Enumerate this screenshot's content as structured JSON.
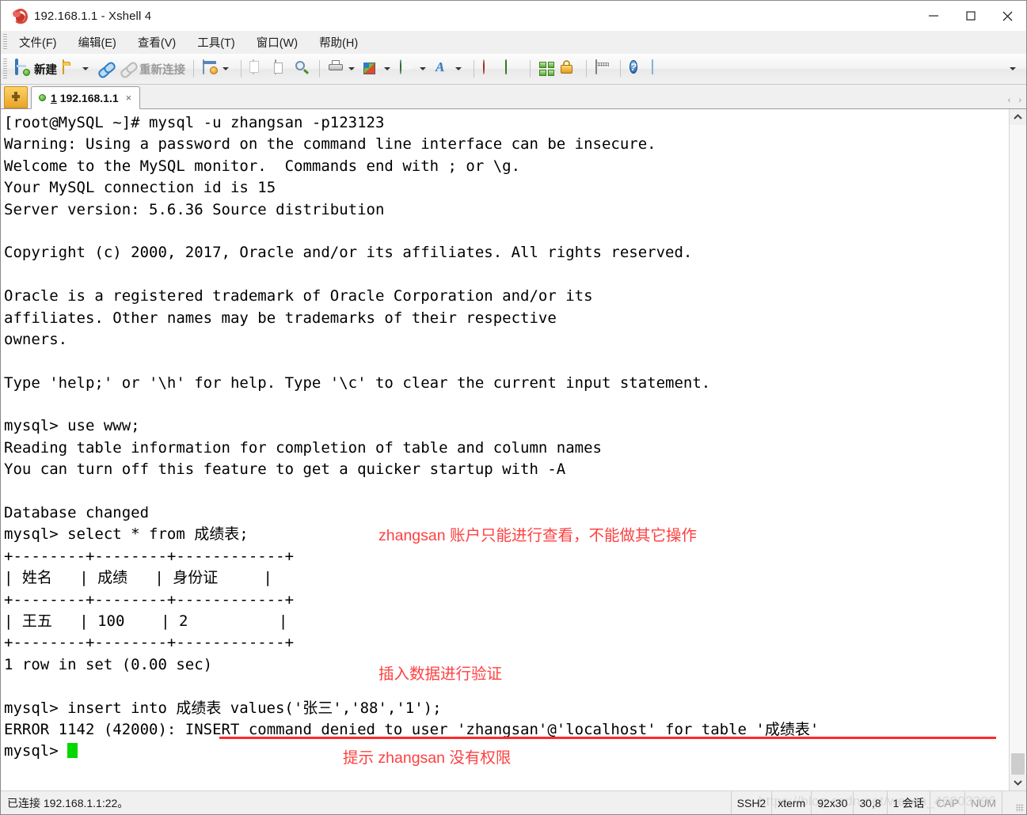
{
  "window": {
    "title": "192.168.1.1 - Xshell 4",
    "app_icon": "snail-icon",
    "minimize": "minimize-icon",
    "maximize": "maximize-icon",
    "close": "close-icon"
  },
  "menubar": {
    "items": [
      {
        "label": "文件(F)"
      },
      {
        "label": "编辑(E)"
      },
      {
        "label": "查看(V)"
      },
      {
        "label": "工具(T)"
      },
      {
        "label": "窗口(W)"
      },
      {
        "label": "帮助(H)"
      }
    ]
  },
  "toolbar": {
    "new_label": "新建",
    "reconnect_label": "重新连接",
    "overflow_label": "▾",
    "buttons": [
      "new-session-button",
      "open-folder-button",
      "connect-button",
      "reconnect-button",
      "properties-button",
      "copy-button",
      "paste-button",
      "find-button",
      "print-button",
      "transfer-button",
      "web-button",
      "font-button",
      "xshell-button",
      "xftp-button",
      "arrange-button",
      "lock-button",
      "keyboard-button",
      "help-button",
      "chat-button"
    ]
  },
  "tabbar": {
    "new_tab": "+",
    "tabs": [
      {
        "index": "1",
        "title": "192.168.1.1",
        "close": "×",
        "active": true
      }
    ],
    "nav_prev": "‹",
    "nav_next": "›"
  },
  "terminal": {
    "lines": [
      "[root@MySQL ~]# mysql -u zhangsan -p123123",
      "Warning: Using a password on the command line interface can be insecure.",
      "Welcome to the MySQL monitor.  Commands end with ; or \\g.",
      "Your MySQL connection id is 15",
      "Server version: 5.6.36 Source distribution",
      "",
      "Copyright (c) 2000, 2017, Oracle and/or its affiliates. All rights reserved.",
      "",
      "Oracle is a registered trademark of Oracle Corporation and/or its",
      "affiliates. Other names may be trademarks of their respective",
      "owners.",
      "",
      "Type 'help;' or '\\h' for help. Type '\\c' to clear the current input statement.",
      "",
      "mysql> use www;",
      "Reading table information for completion of table and column names",
      "You can turn off this feature to get a quicker startup with -A",
      "",
      "Database changed",
      "mysql> select * from 成绩表;",
      "+--------+--------+------------+",
      "| 姓名   | 成绩   | 身份证     |",
      "+--------+--------+------------+",
      "| 王五   | 100    | 2          |",
      "+--------+--------+------------+",
      "1 row in set (0.00 sec)",
      "",
      "mysql> insert into 成绩表 values('张三','88','1');",
      "ERROR 1142 (42000): INSERT command denied to user 'zhangsan'@'localhost' for table '成绩表'",
      "mysql> "
    ],
    "cursor": "block-cursor",
    "annotations": [
      {
        "text": "zhangsan 账户只能进行查看，不能做其它操作",
        "color": "#ff4040"
      },
      {
        "text": "插入数据进行验证",
        "color": "#ff4040"
      },
      {
        "text": "提示 zhangsan 没有权限",
        "color": "#ff4040"
      }
    ],
    "underline_color": "#ff2b2b"
  },
  "scrollbar": {
    "up": "▲",
    "down": "▼"
  },
  "statusbar": {
    "connection": "已连接 192.168.1.1:22。",
    "protocol": "SSH2",
    "terminal_type": "xterm",
    "size": "92x30",
    "cursor_pos": "30,8",
    "sessions": "1 会话",
    "caps": "CAP",
    "num": "NUM",
    "watermark": "https://blog.csdn.net/weixin_46003396"
  }
}
